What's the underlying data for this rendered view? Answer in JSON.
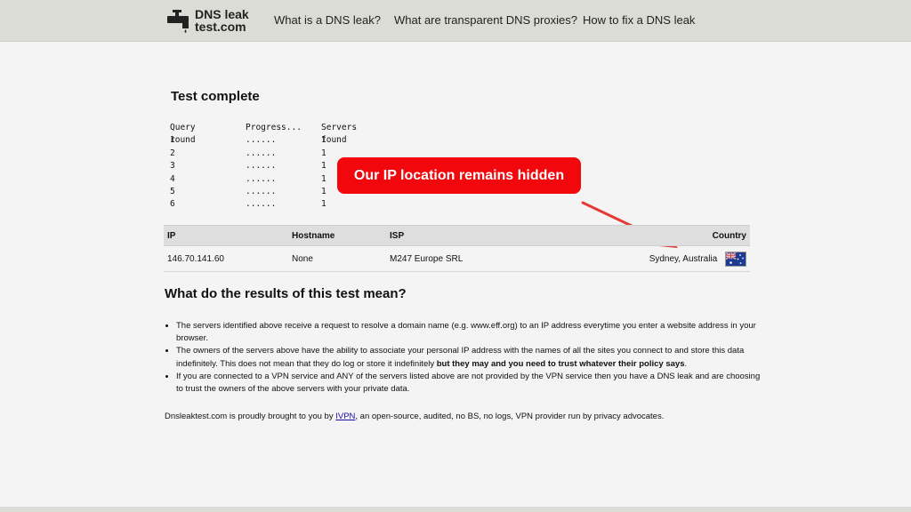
{
  "header": {
    "logo": {
      "line1": "DNS leak",
      "line2": "test.com"
    },
    "nav": [
      {
        "label": "What is a DNS leak?"
      },
      {
        "label": "What are transparent DNS proxies?"
      },
      {
        "label": "How to fix a DNS leak"
      }
    ]
  },
  "test": {
    "title": "Test complete",
    "columns": [
      "Query round",
      "Progress...",
      "Servers found"
    ],
    "rounds": [
      {
        "round": "1",
        "progress": "......",
        "servers": "1"
      },
      {
        "round": "2",
        "progress": "......",
        "servers": "1"
      },
      {
        "round": "3",
        "progress": "......",
        "servers": "1"
      },
      {
        "round": "4",
        "progress": "......",
        "servers": "1"
      },
      {
        "round": "5",
        "progress": "......",
        "servers": "1"
      },
      {
        "round": "6",
        "progress": "......",
        "servers": "1"
      }
    ]
  },
  "callout": {
    "text": "Our IP location remains hidden",
    "color": "#f2070d"
  },
  "results": {
    "headers": {
      "ip": "IP",
      "hostname": "Hostname",
      "isp": "ISP",
      "country": "Country"
    },
    "rows": [
      {
        "ip": "146.70.141.60",
        "hostname": "None",
        "isp": "M247 Europe SRL",
        "country": "Sydney, Australia",
        "flag_icon": "australia-flag-icon"
      }
    ]
  },
  "meaning": {
    "title": "What do the results of this test mean?",
    "points": [
      {
        "text": "The servers identified above receive a request to resolve a domain name (e.g. www.eff.org) to an IP address everytime you enter a website address in your browser."
      },
      {
        "text": "The owners of the servers above have the ability to associate your personal IP address with the names of all the sites you connect to and store this data indefinitely. This does not mean that they do log or store it indefinitely ",
        "bold": "but they may and you need to trust whatever their policy says",
        "tail": "."
      },
      {
        "text": "If you are connected to a VPN service and ANY of the servers listed above are not provided by the VPN service then you have a DNS leak and are choosing to trust the owners of the above servers with your private data."
      }
    ]
  },
  "footer": {
    "before": "Dnsleaktest.com is proudly brought to you by ",
    "link": "IVPN",
    "after": ", an open-source, audited, no BS, no logs, VPN provider run by privacy advocates."
  }
}
